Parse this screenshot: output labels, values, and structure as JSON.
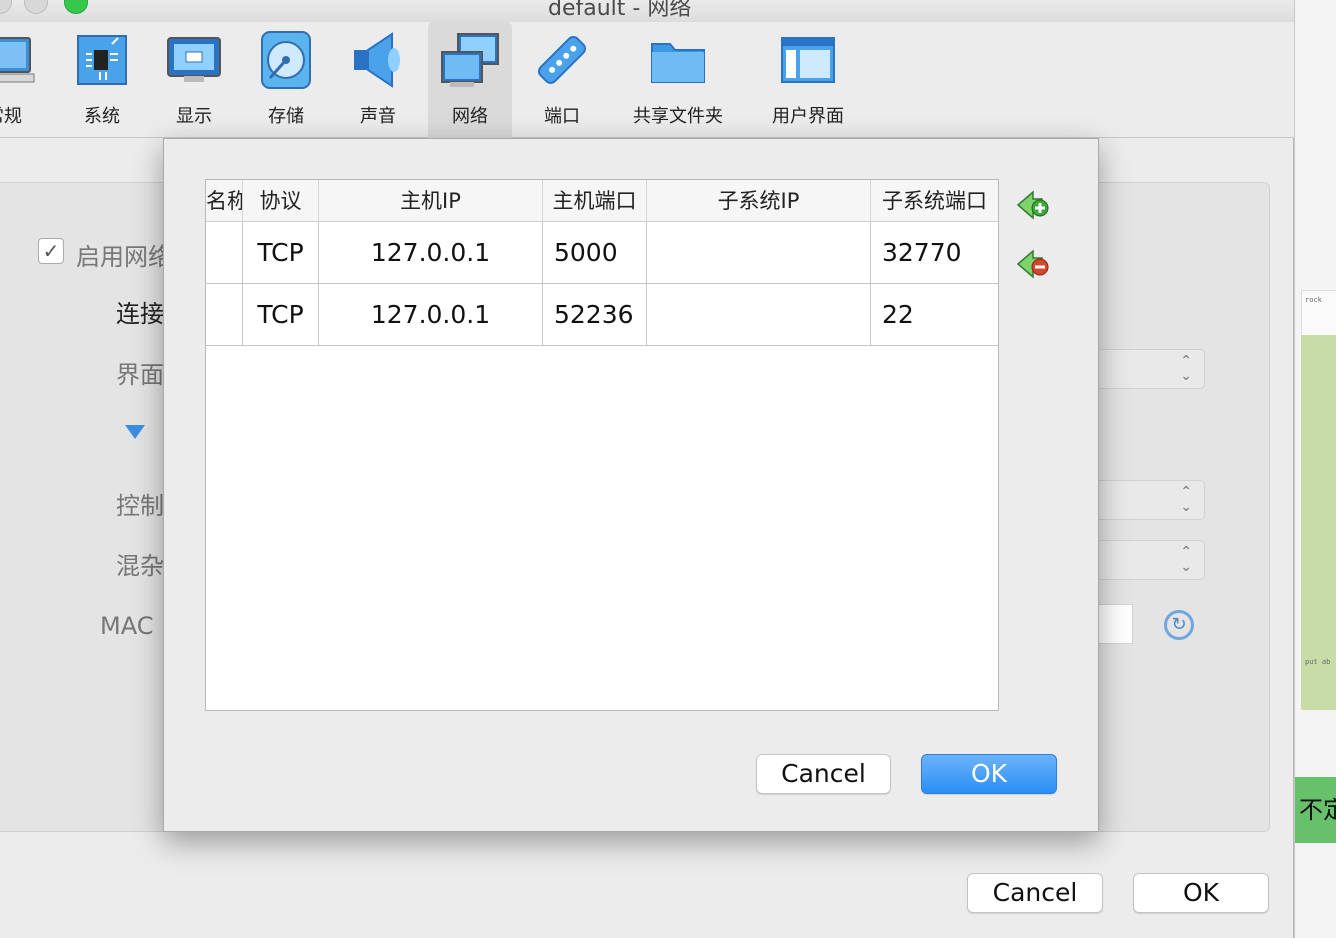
{
  "window": {
    "title": "default - 网络"
  },
  "toolbar": {
    "items": [
      {
        "label": "常规",
        "icon": "monitor-general-icon"
      },
      {
        "label": "系统",
        "icon": "chip-system-icon"
      },
      {
        "label": "显示",
        "icon": "display-icon"
      },
      {
        "label": "存储",
        "icon": "disk-storage-icon"
      },
      {
        "label": "声音",
        "icon": "speaker-icon"
      },
      {
        "label": "网络",
        "icon": "network-icon"
      },
      {
        "label": "端口",
        "icon": "serial-port-icon"
      },
      {
        "label": "共享文件夹",
        "icon": "folder-icon"
      },
      {
        "label": "用户界面",
        "icon": "user-interface-icon"
      }
    ],
    "active": "网络"
  },
  "settings": {
    "enable_label": "启用网络",
    "connect_label": "连接",
    "interface_label": "界面",
    "control_label": "控制",
    "promisc_label": "混杂",
    "mac_label": "MAC"
  },
  "dialog": {
    "columns": [
      "名称",
      "协议",
      "主机IP",
      "主机端口",
      "子系统IP",
      "子系统端口"
    ],
    "rows": [
      {
        "name": "",
        "protocol": "TCP",
        "host_ip": "127.0.0.1",
        "host_port": "5000",
        "guest_ip": "",
        "guest_port": "32770"
      },
      {
        "name": "",
        "protocol": "TCP",
        "host_ip": "127.0.0.1",
        "host_port": "52236",
        "guest_ip": "",
        "guest_port": "22"
      }
    ],
    "cancel_label": "Cancel",
    "ok_label": "OK"
  },
  "footer": {
    "cancel_label": "Cancel",
    "ok_label": "OK"
  },
  "background_app": {
    "tab_text": "rock",
    "snippet_text": "put ab",
    "green_button_text": "不定"
  },
  "colors": {
    "accent_blue": "#2b8ef5",
    "green_traffic": "#35c84a",
    "add_icon_green": "#3aa83a",
    "remove_icon_red": "#d9442e"
  }
}
